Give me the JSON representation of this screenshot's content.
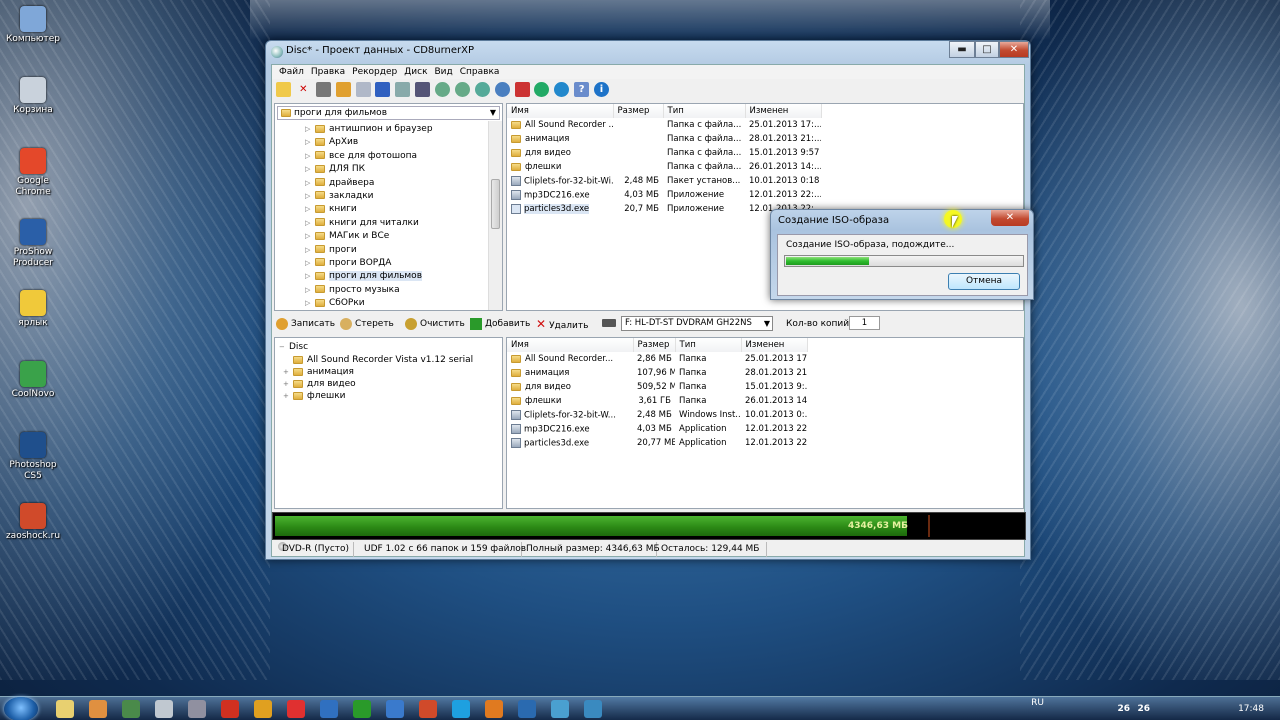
{
  "desktop": {
    "icons": [
      {
        "label": "Компьютер",
        "color": "#7fa7d8"
      },
      {
        "label": "Корзина",
        "color": "#c9d2dc"
      },
      {
        "label": "Google Chrome",
        "color": "#e4482a"
      },
      {
        "label": "ProShow Producer",
        "color": "#2a5fa8"
      },
      {
        "label": "ярлык",
        "color": "#f0c93a"
      },
      {
        "label": "CoolNovo",
        "color": "#3aa24a"
      },
      {
        "label": "Photoshop CS5",
        "color": "#1f4f8c"
      },
      {
        "label": "zaoshock.ru",
        "color": "#d04a2a"
      }
    ]
  },
  "window": {
    "title": "Disc* - Проект данных - CD8urnerXP",
    "controls": {
      "minimize": "▬",
      "maximize": "□",
      "close": "✕"
    },
    "menu": [
      "Файл",
      "Правка",
      "Рекордер",
      "Диск",
      "Вид",
      "Справка"
    ],
    "source_tree": {
      "path": "проги для фильмов",
      "items": [
        "антишпион и браузер",
        "АрХив",
        "все для фотошопа",
        "ДЛЯ ПК",
        "драйвера",
        "закладки",
        "книги",
        "книги для читалки",
        "МАГик и ВСе",
        "проги",
        "проги ВОРДА",
        "проги для фильмов",
        "просто музыка",
        "СбОРки"
      ],
      "selected": "проги для фильмов"
    },
    "source_files": {
      "columns": [
        "Имя",
        "Размер",
        "Тип",
        "Изменен"
      ],
      "rows": [
        {
          "name": "All Sound Recorder ...",
          "size": "",
          "type": "Папка с файла...",
          "modified": "25.01.2013 17:...",
          "kind": "folder"
        },
        {
          "name": "анимация",
          "size": "",
          "type": "Папка с файла...",
          "modified": "28.01.2013 21:...",
          "kind": "folder"
        },
        {
          "name": "для видео",
          "size": "",
          "type": "Папка с файла...",
          "modified": "15.01.2013 9:57",
          "kind": "folder"
        },
        {
          "name": "флешки",
          "size": "",
          "type": "Папка с файла...",
          "modified": "26.01.2013 14:...",
          "kind": "folder"
        },
        {
          "name": "Cliplets-for-32-bit-Wi...",
          "size": "2,48 МБ",
          "type": "Пакет установ...",
          "modified": "10.01.2013 0:18",
          "kind": "file"
        },
        {
          "name": "mp3DC216.exe",
          "size": "4,03 МБ",
          "type": "Приложение",
          "modified": "12.01.2013 22:...",
          "kind": "file"
        },
        {
          "name": "particles3d.exe",
          "size": "20,7 МБ",
          "type": "Приложение",
          "modified": "12.01.2013 22:...",
          "kind": "file"
        }
      ]
    },
    "actions": {
      "burn": "Записать",
      "erase": "Стереть",
      "clear": "Очистить",
      "add": "Добавить",
      "remove": "Удалить",
      "drive": "F: HL-DT-ST DVDRAM GH22NS",
      "copies_label": "Кол-во копий:",
      "copies_value": "1"
    },
    "disc_tree": {
      "root": "Disc",
      "items": [
        {
          "label": "All Sound Recorder Vista v1.12 serial",
          "expand": ""
        },
        {
          "label": "анимация",
          "expand": "+"
        },
        {
          "label": "для видео",
          "expand": "+"
        },
        {
          "label": "флешки",
          "expand": "+"
        }
      ]
    },
    "disc_files": {
      "columns": [
        "Имя",
        "Размер",
        "Тип",
        "Изменен"
      ],
      "rows": [
        {
          "name": "All Sound Recorder...",
          "size": "2,86 МБ",
          "type": "Папка",
          "modified": "25.01.2013 17:...",
          "kind": "folder"
        },
        {
          "name": "анимация",
          "size": "107,96 МБ",
          "type": "Папка",
          "modified": "28.01.2013 21:...",
          "kind": "folder"
        },
        {
          "name": "для видео",
          "size": "509,52 МБ",
          "type": "Папка",
          "modified": "15.01.2013 9:...",
          "kind": "folder"
        },
        {
          "name": "флешки",
          "size": "3,61 ГБ",
          "type": "Папка",
          "modified": "26.01.2013 14:...",
          "kind": "folder"
        },
        {
          "name": "Cliplets-for-32-bit-W...",
          "size": "2,48 МБ",
          "type": "Windows Inst...",
          "modified": "10.01.2013 0:...",
          "kind": "file"
        },
        {
          "name": "mp3DC216.exe",
          "size": "4,03 МБ",
          "type": "Application",
          "modified": "12.01.2013 22:...",
          "kind": "file"
        },
        {
          "name": "particles3d.exe",
          "size": "20,77 МБ",
          "type": "Application",
          "modified": "12.01.2013 22:...",
          "kind": "file"
        }
      ]
    },
    "capacity": {
      "label": "4346,63 МБ",
      "fill_fraction": 0.84
    },
    "status": {
      "disc": "DVD-R (Пусто)",
      "fs": "UDF 1.02 с 66 папок и 159 файлов",
      "total": "Полный размер: 4346,63 МБ",
      "remaining": "Осталось: 129,44 МБ"
    }
  },
  "dialog": {
    "title": "Создание ISO-образа",
    "message": "Создание ISO-образа, подождите...",
    "progress": 0.35,
    "cancel": "Отмена",
    "close": "✕"
  },
  "taskbar": {
    "lang": "RU",
    "tray_badges": [
      "26",
      "26"
    ],
    "clock": "17:48"
  },
  "colors": {
    "accent": "#2fbd2f",
    "capacity": "#2c8a16",
    "folder": "#f6dc88"
  }
}
